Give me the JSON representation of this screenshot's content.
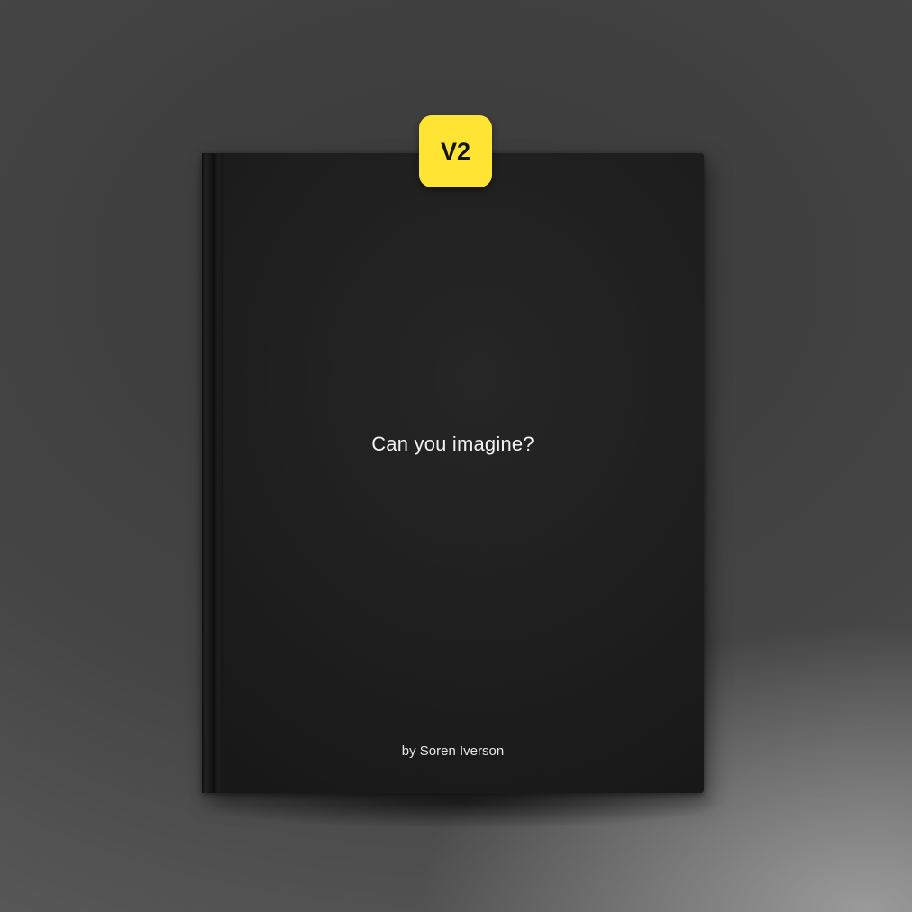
{
  "book": {
    "title": "Can you imagine?",
    "author": "by Soren Iverson",
    "cover_color": "#1e1e1e"
  },
  "badge": {
    "label": "V2",
    "color": "#ffe433"
  }
}
